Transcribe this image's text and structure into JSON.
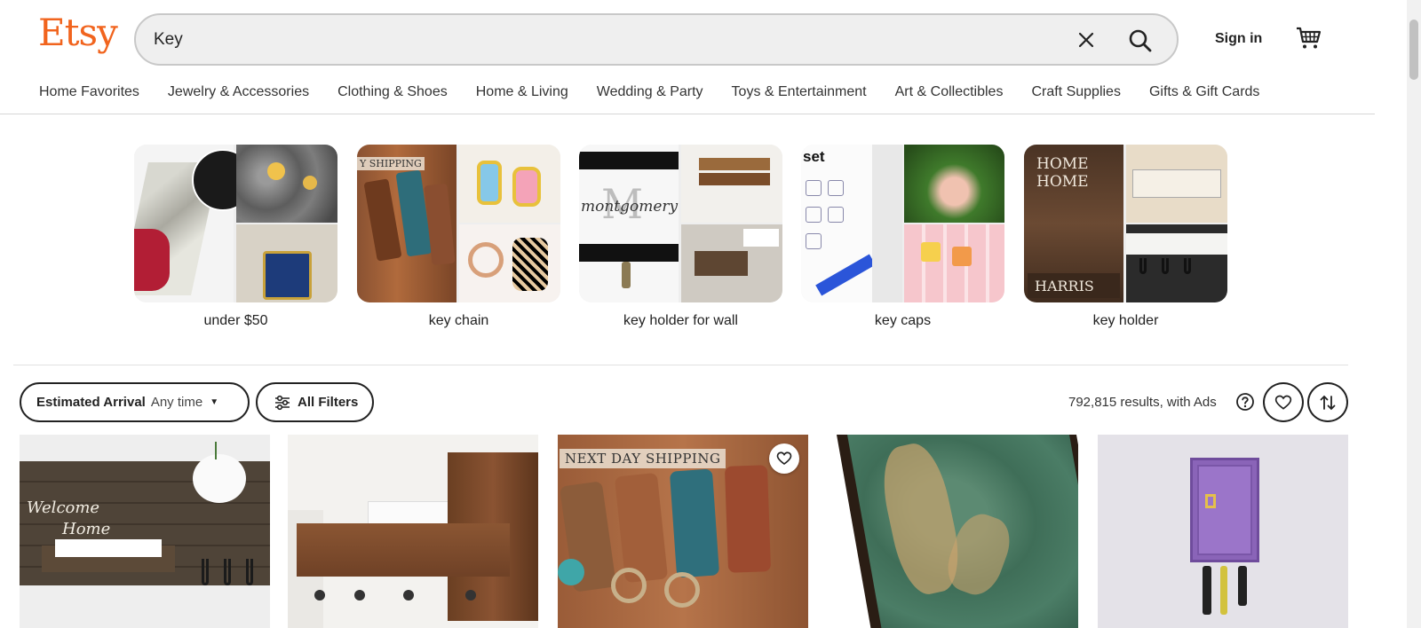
{
  "header": {
    "logo": "Etsy",
    "search": {
      "value": "Key",
      "placeholder": "Search for anything"
    },
    "sign_in": "Sign in",
    "icons": {
      "clear": "close-icon",
      "search": "search-icon",
      "cart": "cart-icon"
    }
  },
  "nav": {
    "items": [
      "Home Favorites",
      "Jewelry & Accessories",
      "Clothing & Shoes",
      "Home & Living",
      "Wedding & Party",
      "Toys & Entertainment",
      "Art & Collectibles",
      "Craft Supplies",
      "Gifts & Gift Cards"
    ]
  },
  "categories": [
    {
      "label": "under $50"
    },
    {
      "label": "key chain"
    },
    {
      "label": "key holder for wall"
    },
    {
      "label": "key caps"
    },
    {
      "label": "key holder"
    }
  ],
  "filters": {
    "arrival_label": "Estimated Arrival",
    "arrival_value": "Any time",
    "all_filters": "All Filters",
    "results_text": "792,815 results, with Ads"
  },
  "listings": [
    {
      "ribbon": ""
    },
    {
      "ribbon": ""
    },
    {
      "ribbon": "NEXT DAY SHIPPING"
    },
    {
      "ribbon": ""
    },
    {
      "ribbon": ""
    }
  ],
  "category_ribbon": "Y SHIPPING",
  "colors": {
    "brand": "#f1641e",
    "text": "#222222",
    "border": "#222222",
    "search_bg": "#efefef"
  }
}
